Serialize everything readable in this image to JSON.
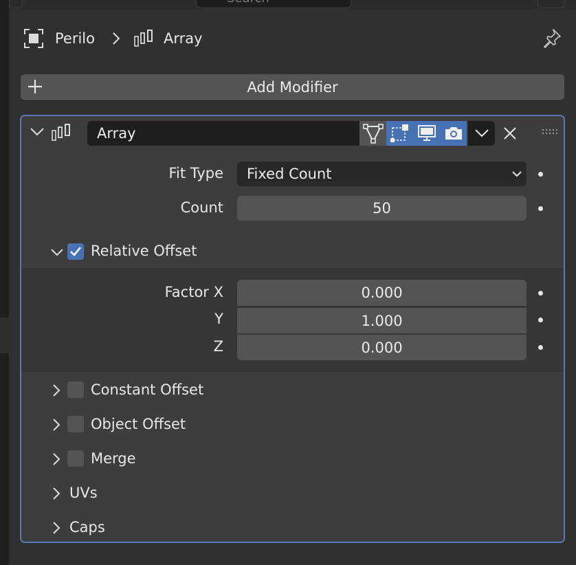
{
  "top": {
    "search_placeholder": "Search"
  },
  "breadcrumb": {
    "object_name": "Perilo",
    "modifier_name": "Array"
  },
  "add_modifier": {
    "label": "Add Modifier"
  },
  "modifier": {
    "name": "Array",
    "fit_type": {
      "label": "Fit Type",
      "value": "Fixed Count"
    },
    "count": {
      "label": "Count",
      "value": "50"
    },
    "relative_offset": {
      "label": "Relative Offset",
      "checked": true,
      "factor_x": {
        "label": "Factor X",
        "value": "0.000"
      },
      "y": {
        "label": "Y",
        "value": "1.000"
      },
      "z": {
        "label": "Z",
        "value": "0.000"
      }
    },
    "constant_offset": {
      "label": "Constant Offset",
      "checked": false
    },
    "object_offset": {
      "label": "Object Offset",
      "checked": false
    },
    "merge": {
      "label": "Merge",
      "checked": false
    },
    "uvs": {
      "label": "UVs"
    },
    "caps": {
      "label": "Caps"
    }
  },
  "colors": {
    "accent": "#4772b3",
    "panel_border": "#5a79b8",
    "button": "#545454",
    "field_dark": "#1e1e1e"
  }
}
